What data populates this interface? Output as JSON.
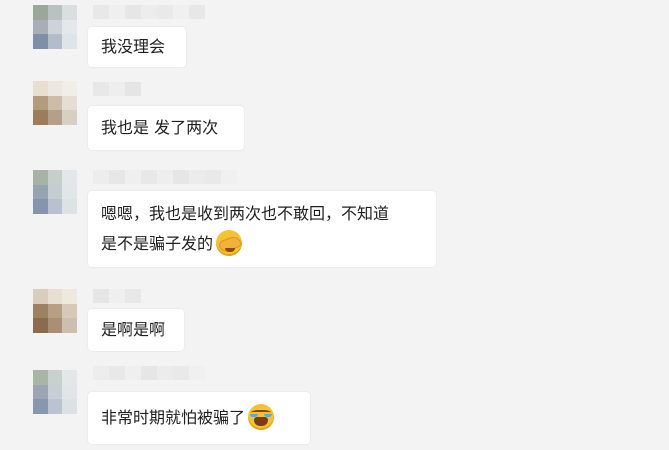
{
  "messages": [
    {
      "lines": [
        "我没理会"
      ]
    },
    {
      "lines": [
        "我也是 发了两次"
      ]
    },
    {
      "lines": [
        "嗯嗯，我也是收到两次也不敢回，不知道",
        "是不是骗子发的"
      ],
      "emoji": "facepalm-face-icon"
    },
    {
      "lines": [
        "是啊是啊"
      ]
    },
    {
      "lines": [
        "非常时期就怕被骗了"
      ],
      "emoji": "crying-face-icon"
    }
  ],
  "colors": {
    "background": "#f3f3f3",
    "bubble": "#ffffff",
    "text": "#1f1f1f"
  }
}
